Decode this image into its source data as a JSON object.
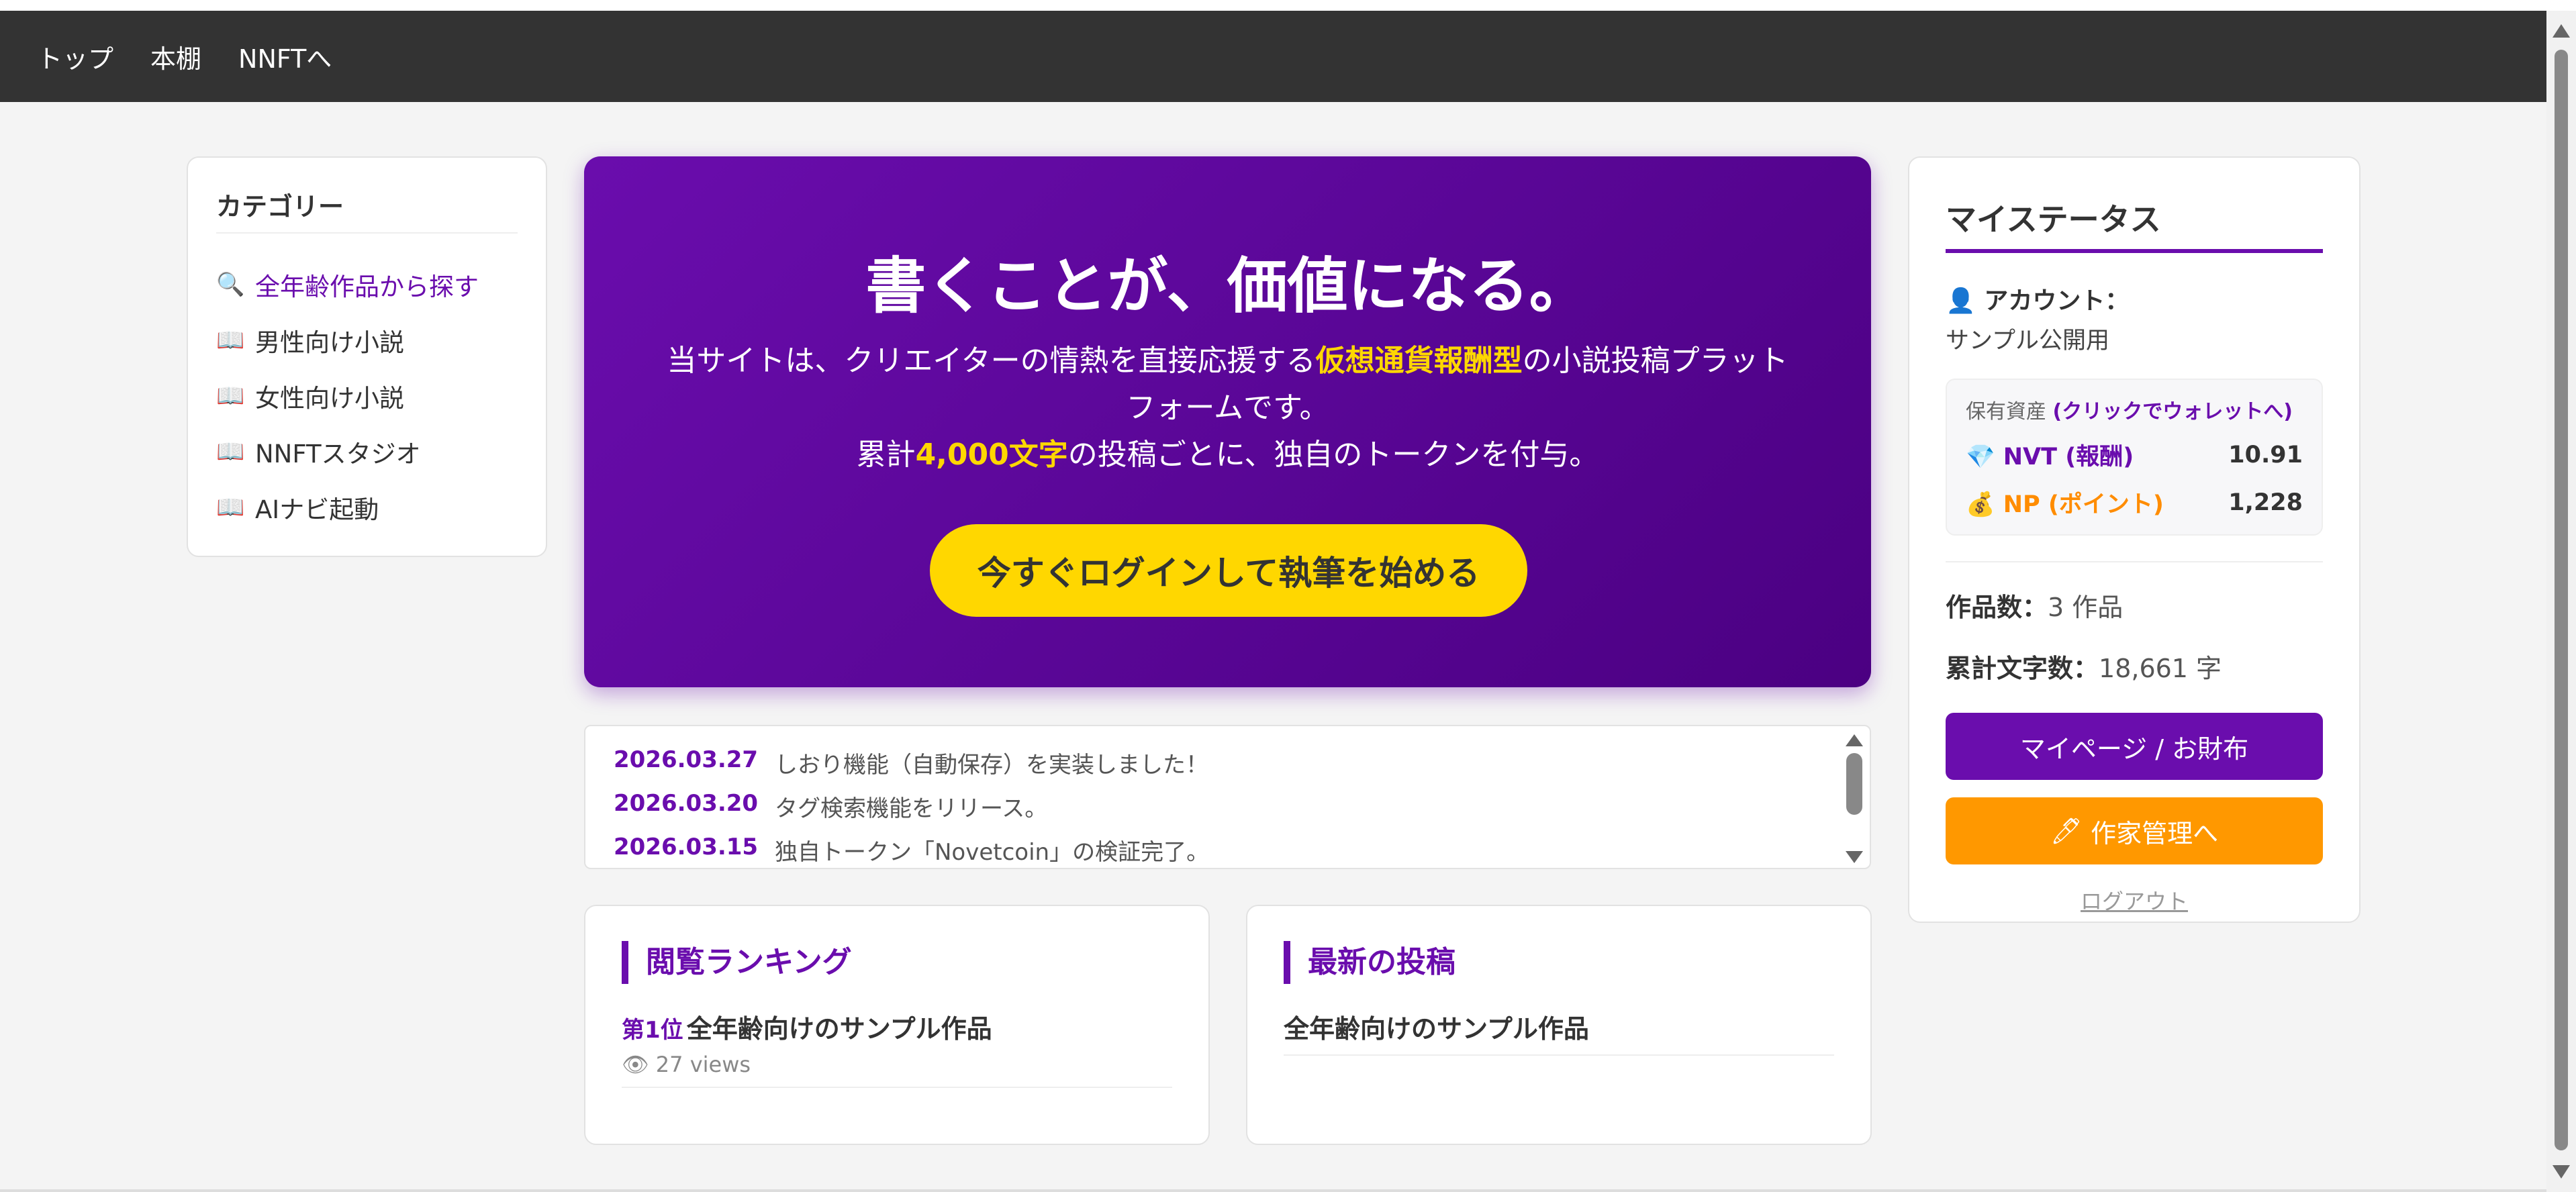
{
  "nav": {
    "items": [
      "トップ",
      "本棚",
      "NNFTへ"
    ]
  },
  "sidebar": {
    "title": "カテゴリー",
    "items": [
      {
        "label": "全年齢作品から探す",
        "icon": "🔍",
        "icon_name": "search-icon"
      },
      {
        "label": "男性向け小説",
        "icon": "📖",
        "icon_name": "book-icon"
      },
      {
        "label": "女性向け小説",
        "icon": "📖",
        "icon_name": "book-icon"
      },
      {
        "label": "NNFTスタジオ",
        "icon": "📖",
        "icon_name": "book-icon"
      },
      {
        "label": "AIナビ起動",
        "icon": "📖",
        "icon_name": "book-icon"
      }
    ]
  },
  "hero": {
    "title": "書くことが、価値になる。",
    "line1_a": "当サイトは、クリエイターの情熱を直接応援する",
    "line1_hl": "仮想通貨報酬型",
    "line1_b": "の小説投稿プラットフォームです。",
    "line2_a": "累計",
    "line2_hl": "4,000文字",
    "line2_b": "の投稿ごとに、独自のトークンを付与。",
    "cta": "今すぐログインして執筆を始める"
  },
  "news": [
    {
      "date": "2026.03.27",
      "text": "しおり機能（自動保存）を実装しました！"
    },
    {
      "date": "2026.03.20",
      "text": "タグ検索機能をリリース。"
    },
    {
      "date": "2026.03.15",
      "text": "独自トークン「Novetcoin」の検証完了。"
    }
  ],
  "ranking": {
    "title": "閲覧ランキング",
    "items": [
      {
        "rank": "第1位",
        "name": "全年齢向けのサンプル作品",
        "views": "27 views"
      }
    ]
  },
  "latest": {
    "title": "最新の投稿",
    "items": [
      {
        "name": "全年齢向けのサンプル作品"
      }
    ]
  },
  "status": {
    "title": "マイステータス",
    "account_label": "アカウント：",
    "account_value": "サンプル公開用",
    "assets_label": "保有資産",
    "assets_link": "(クリックでウォレットへ)",
    "nvt_label": "NVT (報酬)",
    "nvt_value": "10.91",
    "np_label": "NP (ポイント)",
    "np_value": "1,228",
    "works_label": "作品数：",
    "works_value": "3 作品",
    "chars_label": "累計文字数：",
    "chars_value": "18,661 字",
    "mypage_button": "マイページ / お財布",
    "author_button": "作家管理へ",
    "logout": "ログアウト"
  },
  "colors": {
    "accent": "#6a0dad",
    "highlight": "#ffd700",
    "orange": "#ff9800",
    "navbar": "#333333"
  }
}
